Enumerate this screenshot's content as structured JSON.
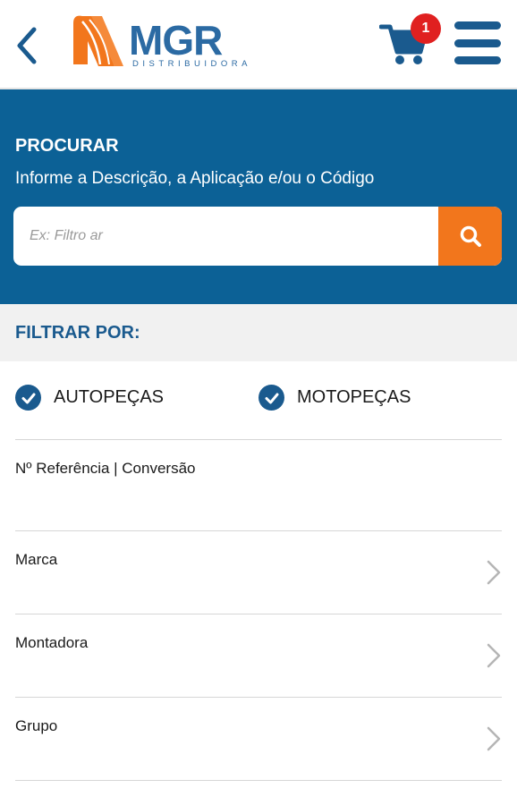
{
  "header": {
    "logo": {
      "brand": "MGR",
      "tagline": "DISTRIBUIDORA"
    },
    "cart": {
      "count": "1"
    },
    "icons": {
      "back": "chevron-left-icon",
      "cart": "shopping-cart-icon",
      "menu": "hamburger-menu-icon"
    }
  },
  "search": {
    "title": "PROCURAR",
    "subtitle": "Informe a Descrição, a Aplicação e/ou o Código",
    "placeholder": "Ex: Filtro ar",
    "value": "",
    "button_icon": "search-icon"
  },
  "filters": {
    "title": "FILTRAR POR:",
    "checkboxes": [
      {
        "label": "AUTOPEÇAS",
        "checked": true
      },
      {
        "label": "MOTOPEÇAS",
        "checked": true
      }
    ],
    "rows": [
      {
        "label": "Nº Referência | Conversão",
        "has_chevron": false
      },
      {
        "label": "Marca",
        "has_chevron": true
      },
      {
        "label": "Montadora",
        "has_chevron": true
      },
      {
        "label": "Grupo",
        "has_chevron": true
      }
    ]
  },
  "colors": {
    "primary_blue": "#0c6196",
    "dark_blue": "#1a5a8e",
    "orange": "#f2761c",
    "badge_red": "#e02020",
    "filter_bg": "#f1f1f1"
  }
}
